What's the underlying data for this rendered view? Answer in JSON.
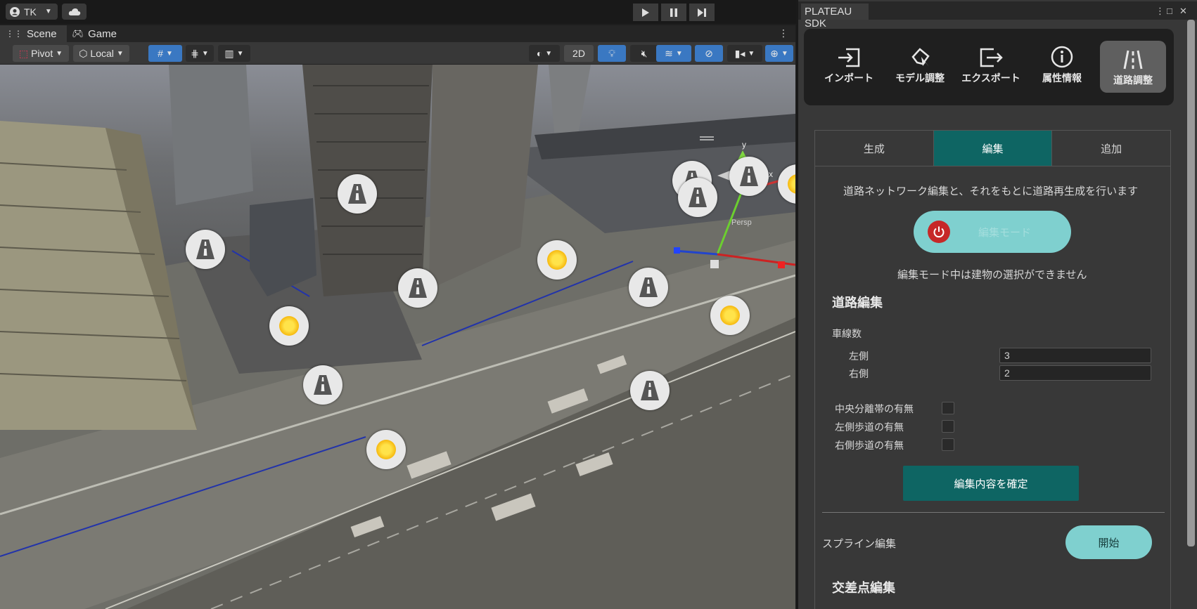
{
  "topbar": {
    "account": "TK",
    "account_icon": "user-circle-icon",
    "cloud_icon": "cloud-icon",
    "play_icons": [
      "play-icon",
      "pause-icon",
      "step-icon"
    ]
  },
  "scene": {
    "tabs": [
      "Scene",
      "Game"
    ],
    "pivot_label": "Pivot",
    "local_label": "Local",
    "mode_2d": "2D",
    "persp_label": "Persp",
    "gizmo_axes": [
      "y",
      "x"
    ]
  },
  "sdk": {
    "title": "PLATEAU SDK",
    "nav": [
      {
        "label": "インポート",
        "icon": "import-icon"
      },
      {
        "label": "モデル調整",
        "icon": "model-adjust-icon"
      },
      {
        "label": "エクスポート",
        "icon": "export-icon"
      },
      {
        "label": "属性情報",
        "icon": "info-icon"
      },
      {
        "label": "道路調整",
        "icon": "road-icon"
      }
    ],
    "modes": [
      "生成",
      "編集",
      "追加"
    ],
    "description": "道路ネットワーク編集と、それをもとに道路再生成を行います",
    "edit_mode_button": "編集モード",
    "edit_mode_note": "編集モード中は建物の選択ができません",
    "road_edit_header": "道路編集",
    "lanes_label": "車線数",
    "left_label": "左側",
    "left_value": "3",
    "right_label": "右側",
    "right_value": "2",
    "median_label": "中央分離帯の有無",
    "left_sidewalk_label": "左側歩道の有無",
    "right_sidewalk_label": "右側歩道の有無",
    "confirm_button": "編集内容を確定",
    "spline_label": "スプライン編集",
    "start_button": "開始",
    "intersection_header": "交差点編集"
  },
  "colors": {
    "accent_teal": "#0e6563",
    "light_teal": "#7fd0cf",
    "power_red": "#c62828"
  }
}
